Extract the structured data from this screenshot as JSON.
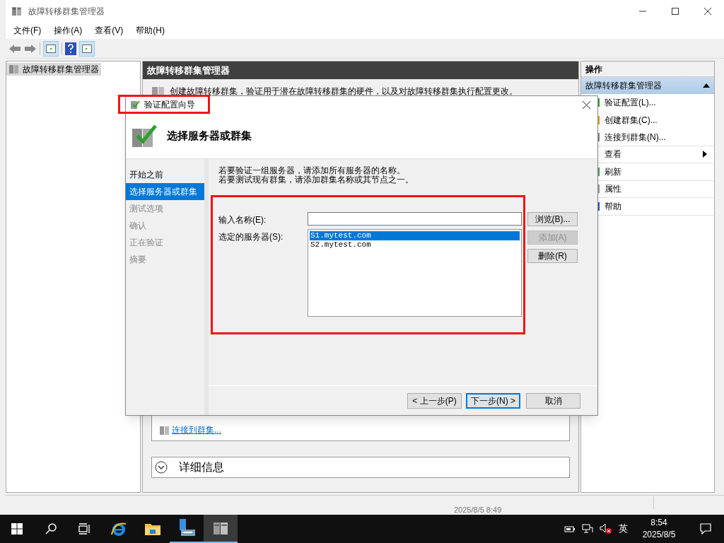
{
  "window": {
    "title": "故障转移群集管理器",
    "menu": [
      "文件(F)",
      "操作(A)",
      "查看(V)",
      "帮助(H)"
    ]
  },
  "tree": {
    "items": [
      {
        "label": "故障转移群集管理器",
        "selected": true
      }
    ]
  },
  "center": {
    "header": "故障转移群集管理器",
    "description": "创建故障转移群集，验证用于潜在故障转移群集的硬件，以及对故障转移群集执行配置更改。",
    "link": "连接到群集...",
    "details": {
      "label": "详细信息",
      "expanded": false
    }
  },
  "actions": {
    "header": "操作",
    "section": {
      "title": "故障转移群集管理器",
      "expanded": true
    },
    "items": [
      {
        "label": "验证配置(L)...",
        "kind": "item"
      },
      {
        "label": "创建群集(C)...",
        "kind": "item"
      },
      {
        "label": "连接到群集(N)...",
        "kind": "item"
      },
      {
        "label": "查看",
        "kind": "submenu"
      },
      {
        "label": "刷新",
        "kind": "item"
      },
      {
        "label": "属性",
        "kind": "item"
      },
      {
        "label": "帮助",
        "kind": "item"
      }
    ]
  },
  "background_text": "2025/8/5 8:49",
  "dialog": {
    "title": "验证配置向导",
    "heading": "选择服务器或群集",
    "steps": [
      {
        "label": "开始之前",
        "selected": false,
        "disabled": false
      },
      {
        "label": "选择服务器或群集",
        "selected": true,
        "disabled": false
      },
      {
        "label": "测试选项",
        "selected": false,
        "disabled": true
      },
      {
        "label": "确认",
        "selected": false,
        "disabled": true
      },
      {
        "label": "正在验证",
        "selected": false,
        "disabled": true
      },
      {
        "label": "摘要",
        "selected": false,
        "disabled": true
      }
    ],
    "instructions": [
      "若要验证一组服务器，请添加所有服务器的名称。",
      "若要测试现有群集，请添加群集名称或其节点之一。"
    ],
    "name_label": "输入名称(E):",
    "servers_label": "选定的服务器(S):",
    "servers": [
      {
        "name": "S1.mytest.com",
        "selected": true
      },
      {
        "name": "S2.mytest.com",
        "selected": false
      }
    ],
    "side_buttons": [
      {
        "label": "浏览(B)...",
        "disabled": false
      },
      {
        "label": "添加(A)",
        "disabled": true
      },
      {
        "label": "删除(R)",
        "disabled": false
      }
    ],
    "footer_buttons": [
      {
        "label": "< 上一步(P)",
        "default": false
      },
      {
        "label": "下一步(N) >",
        "default": true
      },
      {
        "label": "取消",
        "default": false
      }
    ]
  },
  "taskbar": {
    "ime": "英",
    "time": "8:54",
    "date": "2025/8/5"
  }
}
